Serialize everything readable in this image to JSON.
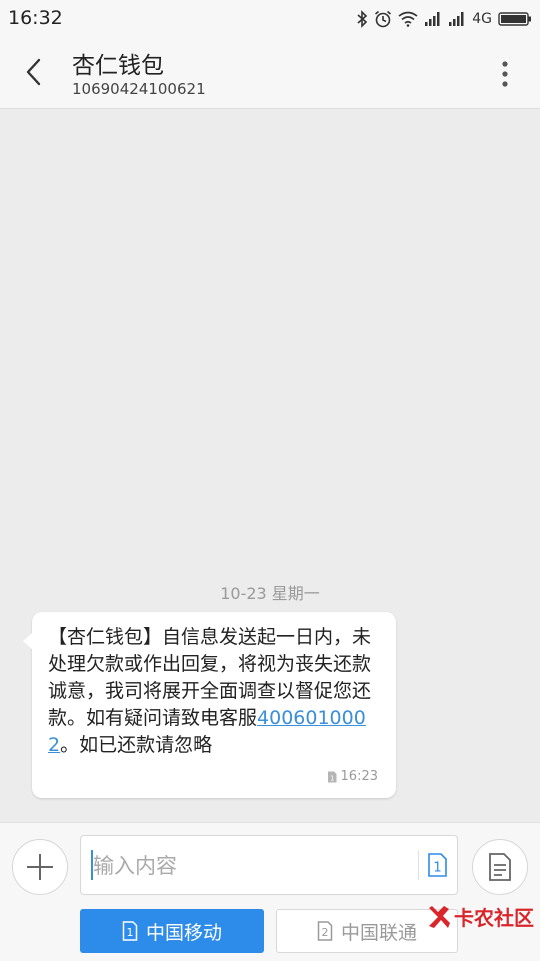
{
  "status_bar": {
    "time": "16:32",
    "network": "4G",
    "icons": [
      "bluetooth-icon",
      "alarm-icon",
      "wifi-icon",
      "signal-icon",
      "signal-icon",
      "battery-icon"
    ]
  },
  "header": {
    "contact_name": "杏仁钱包",
    "contact_number": "10690424100621"
  },
  "conversation": {
    "date_separator": "10-23  星期一",
    "messages": [
      {
        "text_before_link": "【杏仁钱包】自信息发送起一日内，未处理欠款或作出回复，将视为丧失还款诚意，我司将展开全面调查以督促您还款。如有疑问请致电客服",
        "link": "4006010002",
        "text_after_link": "。如已还款请忽略",
        "sim_slot": "1",
        "time": "16:23"
      }
    ]
  },
  "composer": {
    "placeholder": "输入内容",
    "sim_mini": "1",
    "sim1_number": "1",
    "sim1_label": "中国移动",
    "sim2_number": "2",
    "sim2_label": "中国联通"
  },
  "watermark": {
    "text": "卡农社区"
  },
  "colors": {
    "accent": "#2d8bea",
    "link": "#3a8fd9",
    "background": "#ececec",
    "watermark": "#d8262b"
  }
}
